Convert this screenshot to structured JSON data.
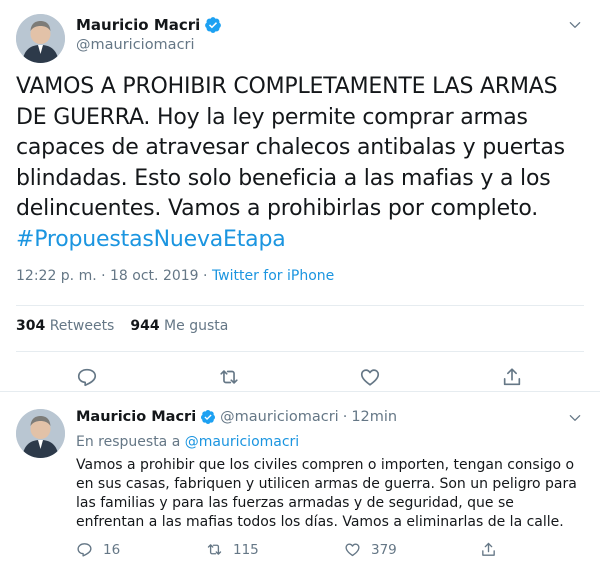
{
  "tweet": {
    "author": {
      "display_name": "Mauricio Macri",
      "handle": "@mauriciomacri",
      "verified": true
    },
    "text": "VAMOS A PROHIBIR COMPLETAMENTE LAS ARMAS DE GUERRA. Hoy la ley permite comprar armas capaces de atravesar chalecos antibalas y puertas blindadas. Esto solo beneficia a las mafias y a los delincuentes. Vamos a prohibirlas por completo.",
    "hashtag": "#PropuestasNuevaEtapa",
    "timestamp": "12:22 p. m. · 18 oct. 2019",
    "separator": " · ",
    "source": "Twitter for iPhone",
    "stats": {
      "retweets_count": "304",
      "retweets_label": "Retweets",
      "likes_count": "944",
      "likes_label": "Me gusta"
    },
    "actions": [
      "reply-icon",
      "retweet-icon",
      "like-icon",
      "share-icon"
    ]
  },
  "reply": {
    "author": {
      "display_name": "Mauricio Macri",
      "handle": "@mauriciomacri",
      "verified": true
    },
    "dot": "·",
    "time": "12min",
    "in_reply_prefix": "En respuesta a",
    "in_reply_mention": "@mauriciomacri",
    "text": "Vamos a prohibir que los civiles compren o importen, tengan consigo o en sus casas, fabriquen y utilicen armas de guerra. Son un peligro para las familias y para las fuerzas armadas y de seguridad, que se enfrentan a las mafias todos los días. Vamos a eliminarlas de la calle.",
    "counts": {
      "replies": "16",
      "retweets": "115",
      "likes": "379"
    }
  },
  "colors": {
    "accent": "#1b95e0",
    "secondary_text": "#657786",
    "primary_text": "#14171a",
    "divider": "#e6ecf0"
  }
}
